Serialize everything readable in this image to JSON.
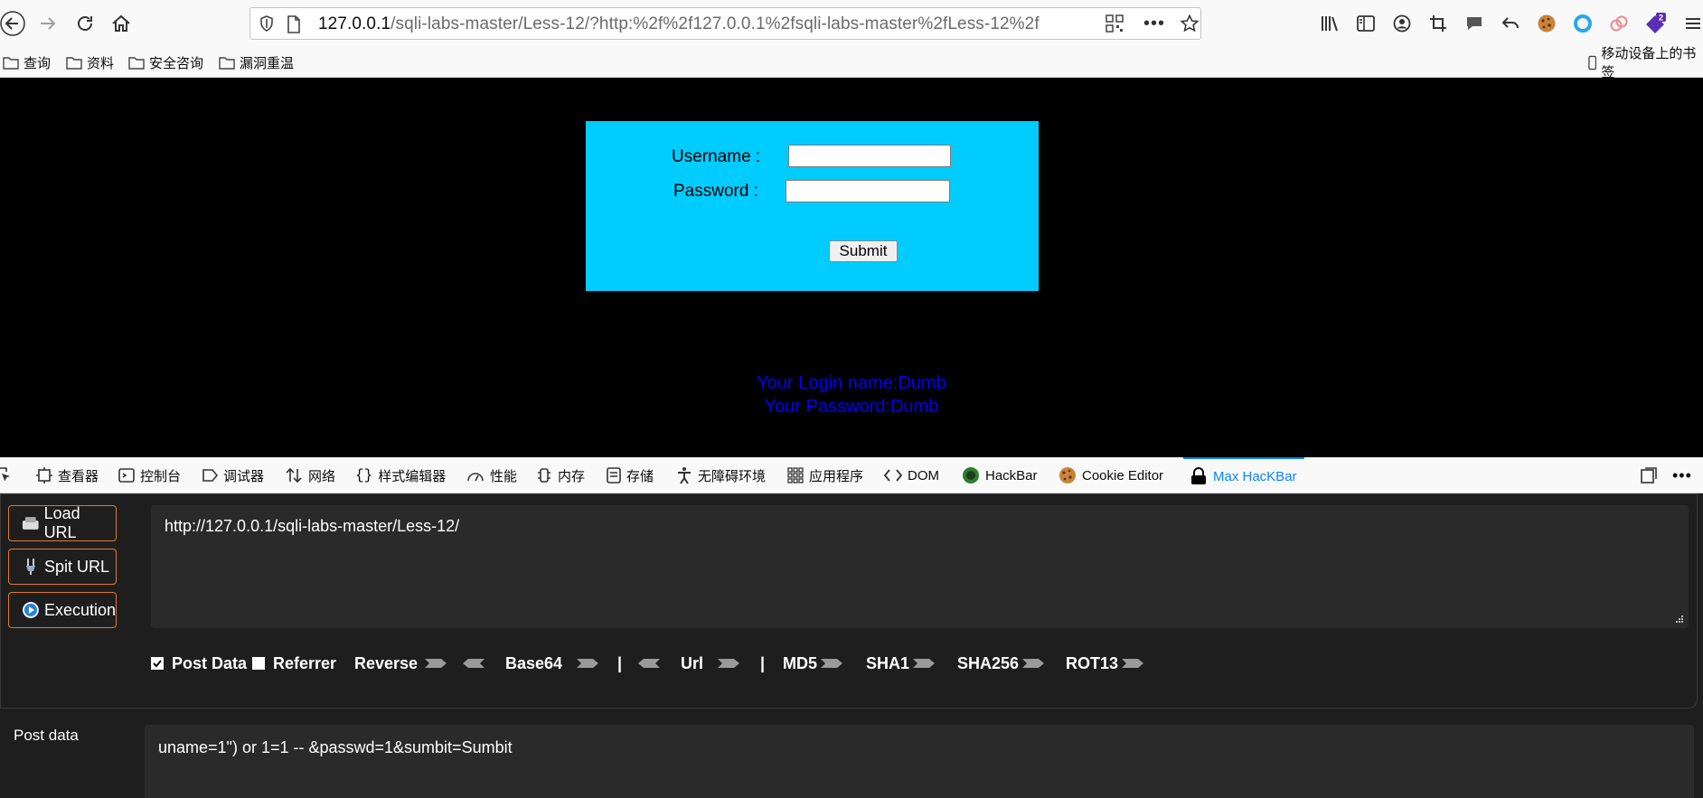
{
  "toolbar": {
    "url_host": "127.0.0.1",
    "url_path": "/sqli-labs-master/Less-12/?http:%2f%2f127.0.0.1%2fsqli-labs-master%2fLess-12%2f",
    "extension_badge": "2"
  },
  "bookmarks": {
    "items": [
      "查询",
      "资料",
      "安全咨询",
      "漏洞重温"
    ],
    "mobile": "移动设备上的书签"
  },
  "page": {
    "username_label": "Username :",
    "password_label": "Password :",
    "submit_label": "Submit",
    "login_name": "Your Login name:Dumb",
    "password_result": "Your Password:Dumb",
    "colors": {
      "box": "#00ccff",
      "result_text": "#0000ff",
      "background": "#000000"
    }
  },
  "devtools": {
    "tabs": [
      "查看器",
      "控制台",
      "调试器",
      "网络",
      "样式编辑器",
      "性能",
      "内存",
      "存储",
      "无障碍环境",
      "应用程序",
      "DOM",
      "HackBar",
      "Cookie Editor",
      "Max HacKBar"
    ],
    "active_tab": "Max HacKBar"
  },
  "hackbar": {
    "buttons": [
      "Load URL",
      "Spit URL",
      "Execution"
    ],
    "url_value": "http://127.0.0.1/sqli-labs-master/Less-12/",
    "post_data_label": "Post Data",
    "post_data_checked": true,
    "referrer_label": "Referrer",
    "referrer_checked": false,
    "reverse": "Reverse",
    "base64": "Base64",
    "separator": "|",
    "url": "Url",
    "md5": "MD5",
    "sha1": "SHA1",
    "sha256": "SHA256",
    "rot13": "ROT13",
    "post_label": "Post data",
    "post_value": "uname=1\") or 1=1 -- &passwd=1&sumbit=Sumbit"
  }
}
